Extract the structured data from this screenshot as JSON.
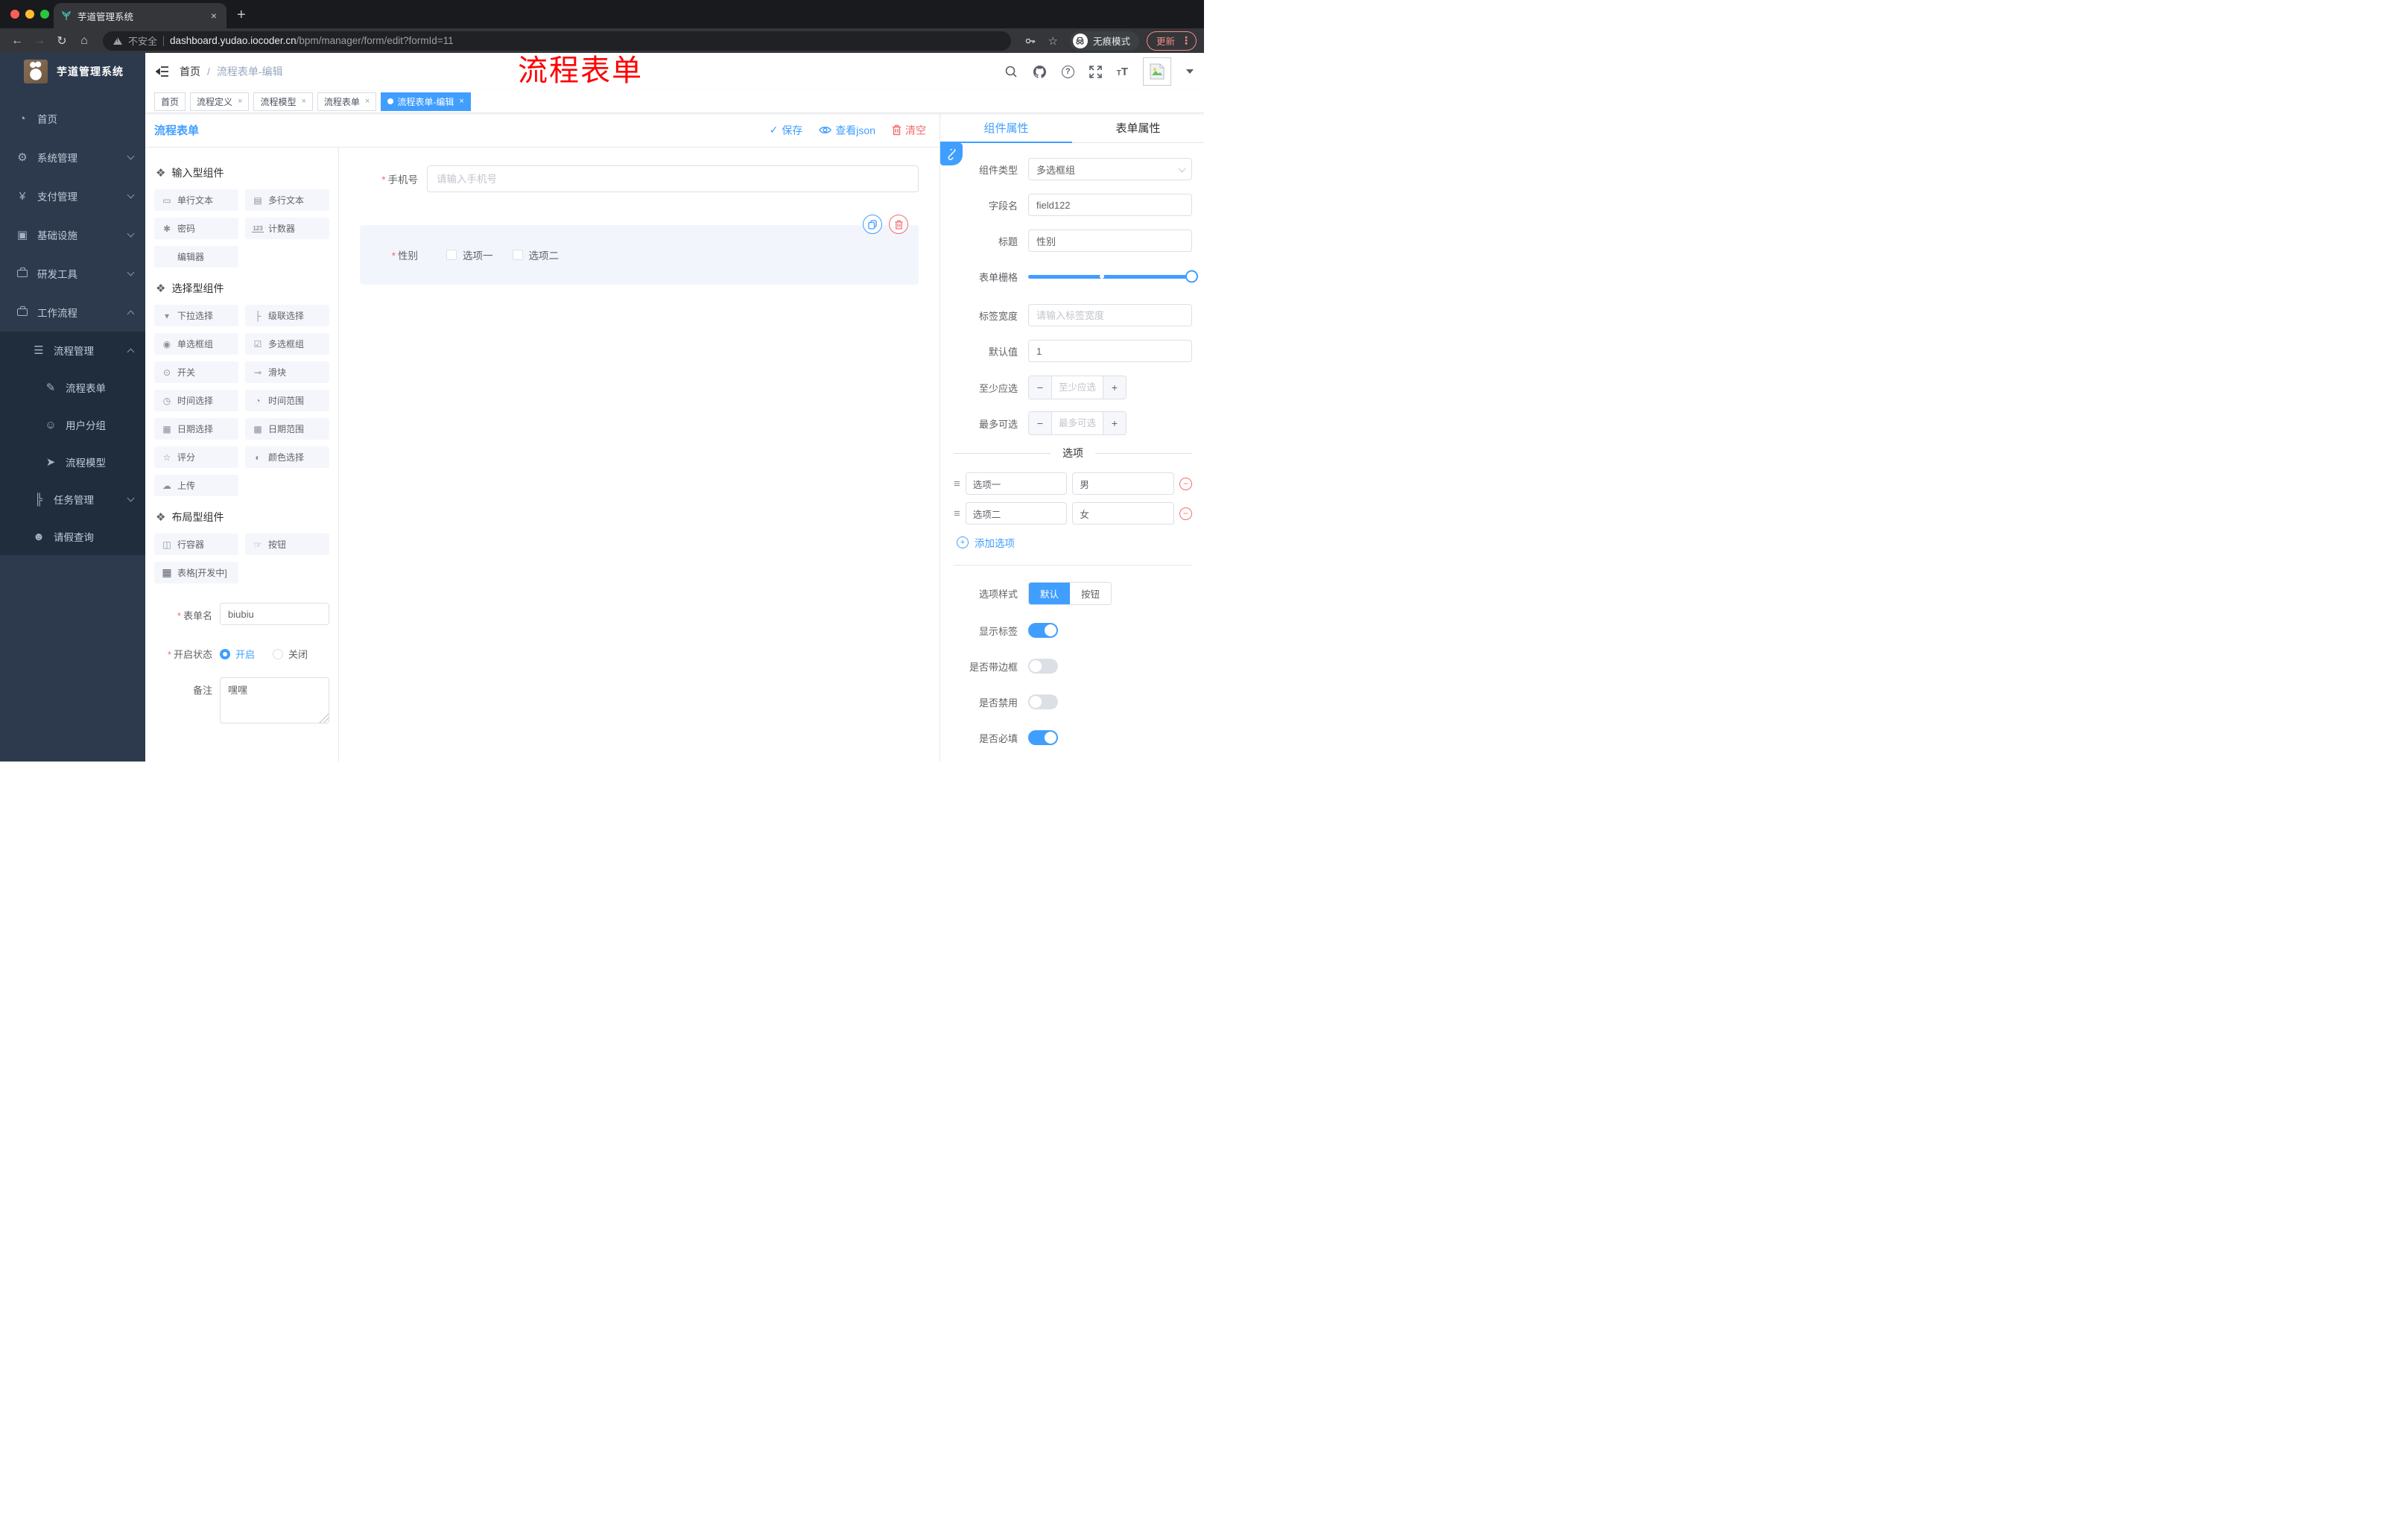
{
  "browser": {
    "tab_title": "芋道管理系统",
    "security_label": "不安全",
    "url_domain": "dashboard.yudao.iocoder.cn",
    "url_path": "/bpm/manager/form/edit?formId=11",
    "incognito_label": "无痕模式",
    "update_label": "更新"
  },
  "sidebar": {
    "logo_title": "芋道管理系统",
    "items": [
      {
        "label": "首页"
      },
      {
        "label": "系统管理"
      },
      {
        "label": "支付管理"
      },
      {
        "label": "基础设施"
      },
      {
        "label": "研发工具"
      },
      {
        "label": "工作流程"
      }
    ],
    "sub": [
      {
        "label": "流程管理"
      },
      {
        "label": "流程表单"
      },
      {
        "label": "用户分组"
      },
      {
        "label": "流程模型"
      },
      {
        "label": "任务管理"
      },
      {
        "label": "请假查询"
      }
    ]
  },
  "navbar": {
    "breadcrumb_home": "首页",
    "breadcrumb_sep": "/",
    "breadcrumb_current": "流程表单-编辑",
    "annotation": "流程表单"
  },
  "tags": {
    "items": [
      {
        "label": "首页"
      },
      {
        "label": "流程定义"
      },
      {
        "label": "流程模型"
      },
      {
        "label": "流程表单"
      },
      {
        "label": "流程表单-编辑"
      }
    ]
  },
  "designer": {
    "title": "流程表单",
    "save": "保存",
    "view_json": "查看json",
    "clear": "清空"
  },
  "groups": {
    "g0": {
      "title": "输入型组件",
      "items": [
        "单行文本",
        "多行文本",
        "密码",
        "计数器",
        "编辑器"
      ]
    },
    "g1": {
      "title": "选择型组件",
      "items": [
        "下拉选择",
        "级联选择",
        "单选框组",
        "多选框组",
        "开关",
        "滑块",
        "时间选择",
        "时间范围",
        "日期选择",
        "日期范围",
        "评分",
        "颜色选择",
        "上传"
      ]
    },
    "g2": {
      "title": "布局型组件",
      "items": [
        "行容器",
        "按钮",
        "表格[开发中]"
      ]
    }
  },
  "meta": {
    "name_label": "表单名",
    "name_value": "biubiu",
    "status_label": "开启状态",
    "status_on": "开启",
    "status_off": "关闭",
    "remark_label": "备注",
    "remark_value": "嘿嘿"
  },
  "canvas": {
    "phone_label": "手机号",
    "phone_placeholder": "请输入手机号",
    "gender_label": "性别",
    "gender_opt1": "选项一",
    "gender_opt2": "选项二"
  },
  "props": {
    "tab_component": "组件属性",
    "tab_form": "表单属性",
    "type_label": "组件类型",
    "type_value": "多选框组",
    "field_label": "字段名",
    "field_value": "field122",
    "title_label": "标题",
    "title_value": "性别",
    "grid_label": "表单栅格",
    "labelwidth_label": "标签宽度",
    "labelwidth_placeholder": "请输入标签宽度",
    "default_label": "默认值",
    "default_value": "1",
    "min_label": "至少应选",
    "min_placeholder": "至少应选",
    "max_label": "最多可选",
    "max_placeholder": "最多可选",
    "options_title": "选项",
    "options": [
      {
        "name": "选项一",
        "value": "男"
      },
      {
        "name": "选项二",
        "value": "女"
      }
    ],
    "add_option": "添加选项",
    "style_label": "选项样式",
    "style_default": "默认",
    "style_button": "按钮",
    "switches": [
      {
        "label": "显示标签",
        "on": true
      },
      {
        "label": "是否带边框",
        "on": false
      },
      {
        "label": "是否禁用",
        "on": false
      },
      {
        "label": "是否必填",
        "on": true
      }
    ]
  }
}
